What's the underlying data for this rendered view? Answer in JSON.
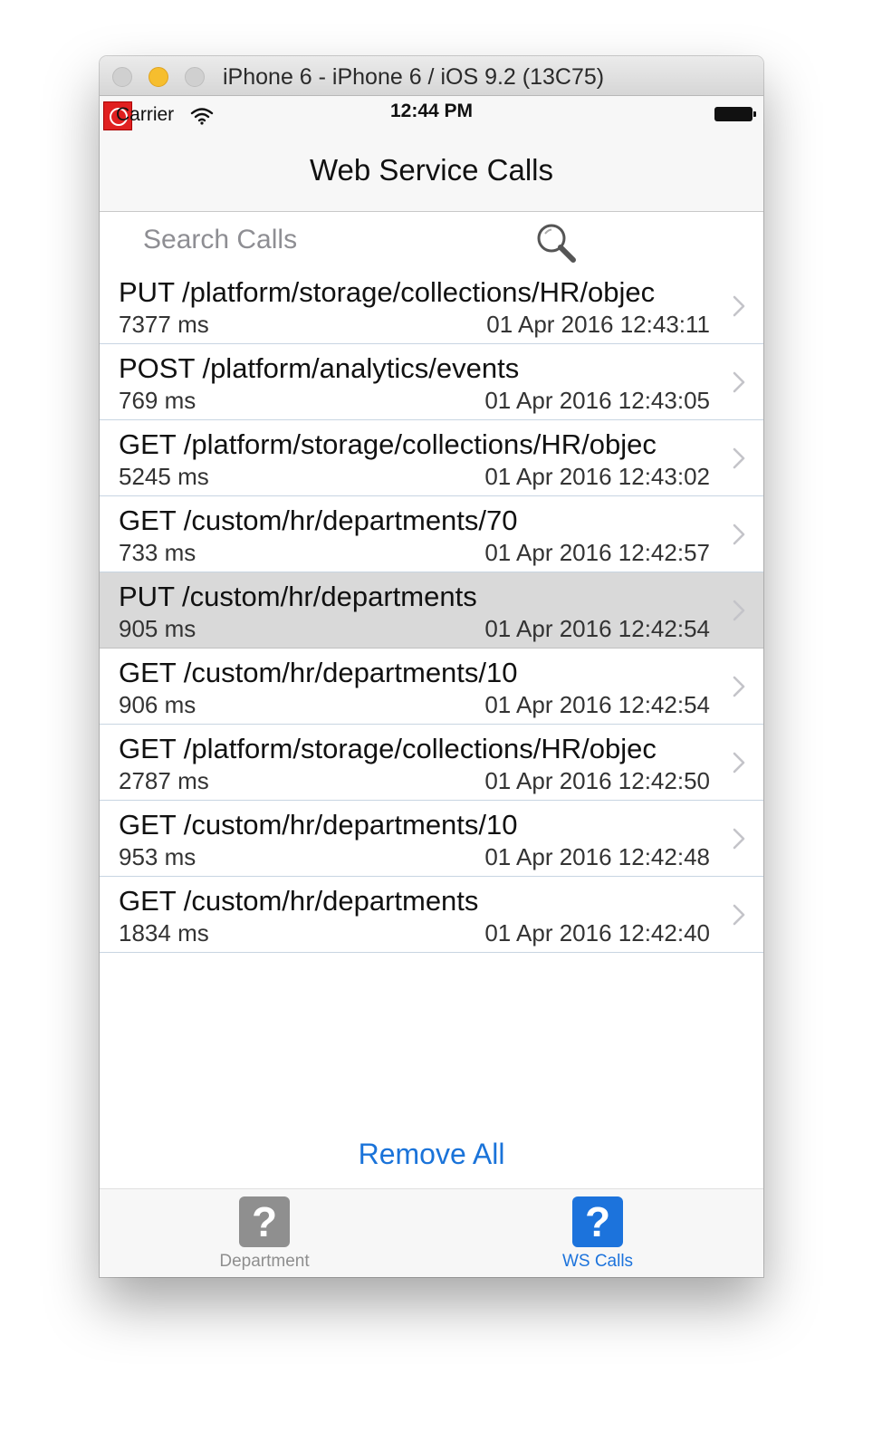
{
  "window": {
    "title": "iPhone 6 - iPhone 6 / iOS 9.2 (13C75)"
  },
  "status_bar": {
    "carrier": "Carrier",
    "time": "12:44 PM"
  },
  "nav": {
    "title": "Web Service Calls"
  },
  "search": {
    "placeholder": "Search Calls",
    "value": ""
  },
  "calls": [
    {
      "request": "PUT /platform/storage/collections/HR/objec",
      "duration": "7377 ms",
      "timestamp": "01 Apr 2016 12:43:11",
      "selected": false
    },
    {
      "request": "POST /platform/analytics/events",
      "duration": "769 ms",
      "timestamp": "01 Apr 2016 12:43:05",
      "selected": false
    },
    {
      "request": "GET /platform/storage/collections/HR/objec",
      "duration": "5245 ms",
      "timestamp": "01 Apr 2016 12:43:02",
      "selected": false
    },
    {
      "request": "GET /custom/hr/departments/70",
      "duration": "733 ms",
      "timestamp": "01 Apr 2016 12:42:57",
      "selected": false
    },
    {
      "request": "PUT /custom/hr/departments",
      "duration": "905 ms",
      "timestamp": "01 Apr 2016 12:42:54",
      "selected": true
    },
    {
      "request": "GET /custom/hr/departments/10",
      "duration": "906 ms",
      "timestamp": "01 Apr 2016 12:42:54",
      "selected": false
    },
    {
      "request": "GET /platform/storage/collections/HR/objec",
      "duration": "2787 ms",
      "timestamp": "01 Apr 2016 12:42:50",
      "selected": false
    },
    {
      "request": "GET /custom/hr/departments/10",
      "duration": "953 ms",
      "timestamp": "01 Apr 2016 12:42:48",
      "selected": false
    },
    {
      "request": "GET /custom/hr/departments",
      "duration": "1834 ms",
      "timestamp": "01 Apr 2016 12:42:40",
      "selected": false
    }
  ],
  "actions": {
    "remove_all": "Remove All"
  },
  "tabs": [
    {
      "label": "Department",
      "icon": "question-icon",
      "active": false
    },
    {
      "label": "WS Calls",
      "icon": "question-icon",
      "active": true
    }
  ],
  "colors": {
    "accent": "#1c73dc",
    "selected_row": "#d9d9d9",
    "inactive_tab": "#8f8f8f"
  }
}
